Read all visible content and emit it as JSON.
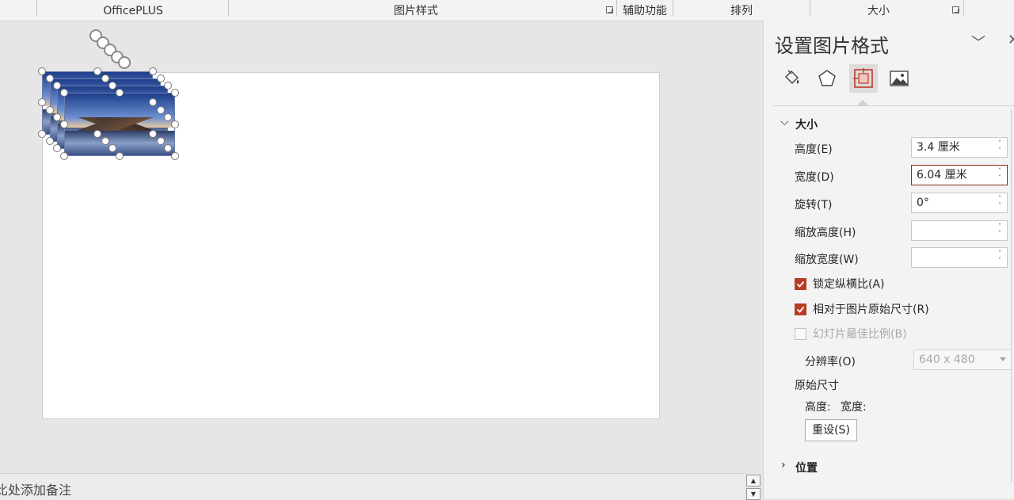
{
  "ribbon": {
    "groups": [
      "OfficePLUS",
      "图片样式",
      "辅助功能",
      "排列",
      "大小"
    ]
  },
  "notes": {
    "placeholder": "比处添加备注"
  },
  "panel": {
    "title": "设置图片格式",
    "tabs": [
      {
        "icon": "fill-bucket-icon"
      },
      {
        "icon": "pentagon-effects-icon"
      },
      {
        "icon": "size-properties-icon",
        "selected": true
      },
      {
        "icon": "picture-icon"
      }
    ],
    "size_section": {
      "header": "大小",
      "height_label": "高度(E)",
      "height_value": "3.4 厘米",
      "width_label": "宽度(D)",
      "width_value": "6.04 厘米",
      "rotation_label": "旋转(T)",
      "rotation_value": "0°",
      "scale_height_label": "缩放高度(H)",
      "scale_height_value": "",
      "scale_width_label": "缩放宽度(W)",
      "scale_width_value": "",
      "lock_aspect_label": "锁定纵横比(A)",
      "lock_aspect_checked": true,
      "relative_label": "相对于图片原始尺寸(R)",
      "relative_checked": true,
      "best_scale_label": "幻灯片最佳比例(B)",
      "best_scale_checked": false,
      "resolution_label": "分辨率(O)",
      "resolution_value": "640 x 480",
      "original_size_label": "原始尺寸",
      "original_height_label": "高度:",
      "original_width_label": "宽度:",
      "reset_label": "重设(S)"
    },
    "position_section": {
      "header": "位置"
    }
  },
  "colors": {
    "accent": "#b83c24",
    "focus_border": "#8a2a1a"
  }
}
